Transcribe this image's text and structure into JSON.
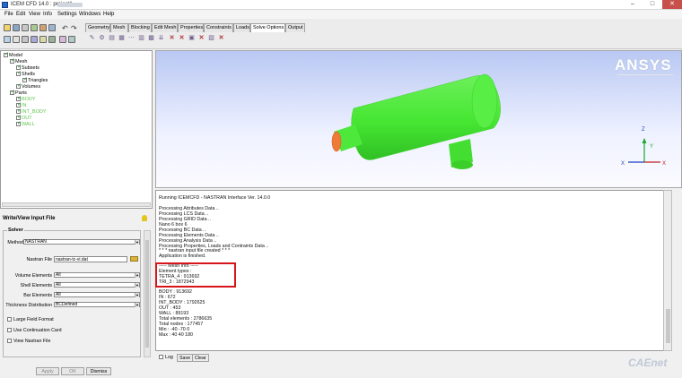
{
  "window": {
    "title": "ICEM CFD 14.0 : project1",
    "controls": {
      "min": "–",
      "max": "□",
      "close": "✕"
    }
  },
  "menu": [
    "File",
    "Edit",
    "View",
    "Info",
    "Settings",
    "Windows",
    "Help"
  ],
  "tabs": [
    "Geometry",
    "Mesh",
    "Blocking",
    "Edit Mesh",
    "Properties",
    "Constraints",
    "Loads",
    "Solve Options",
    "Output"
  ],
  "active_tab": "Solve Options",
  "tree": {
    "model": "Model",
    "mesh": "Mesh",
    "subsets": "Subsets",
    "shells": "Shells",
    "triangles": "Triangles",
    "volumes": "Volumes",
    "parts": "Parts",
    "part_items": [
      "BODY",
      "IN",
      "INT_BODY",
      "OUT",
      "WALL"
    ]
  },
  "panel": {
    "title": "Write/View Input File",
    "solver_group": "Solver",
    "method_label": "Method",
    "method_value": "NASTRAN",
    "file_label": "Nastran File",
    "file_value": "nastran-tc-vi.dat",
    "volume_label": "Volume Elements",
    "volume_value": "All",
    "shell_label": "Shell Elements",
    "shell_value": "All",
    "bar_label": "Bar Elements",
    "bar_value": "All",
    "thickness_label": "Thickness Distribution",
    "thickness_value": "BCDefined",
    "check_large": "Large Field Format",
    "check_continuation": "Use Continuation Card",
    "check_view": "View Nastran File"
  },
  "buttons": {
    "apply": "Apply",
    "ok": "OK",
    "dismiss": "Dismiss"
  },
  "brand": "ANSYS",
  "axes": {
    "z": "Z",
    "y": "Y",
    "x": "X"
  },
  "console": {
    "lines": [
      "Running ICEMCFD - NASTRAN Interface Ver. 14.0.0",
      "",
      "Processing Attributes Data ..",
      "Processing LCS Data ..",
      "Processing GRID Data ..",
      "Nano 6 box 6",
      "Processing BC Data ..",
      "Processing Elements Data ..",
      "Processing Analysis Data ..",
      "Processing Properties, Loads and Contraints Data ..",
      "* * * nastran input file created * * *",
      "Application is finished.",
      "",
      "----- Mesh Info -----",
      "Element types :",
      "    TETRA_4 : 913692",
      "    TRI_3 : 1872943",
      "",
      "    BODY : 913692",
      "    IN : 672",
      "    INT_BODY : 1792625",
      "    OUT : 453",
      "    WALL : 89193",
      "Total elements : 2786635",
      "Total nodes : 177457",
      "Min : -40 -70 0",
      "Max : 40 40 180"
    ],
    "log_label": "Log",
    "save_label": "Save",
    "clear_label": "Clear"
  },
  "watermark": "CAEnet",
  "colors": {
    "mesh_green": "#46e632",
    "inlet_orange": "#f07a38",
    "highlight_red": "#d7141a"
  }
}
